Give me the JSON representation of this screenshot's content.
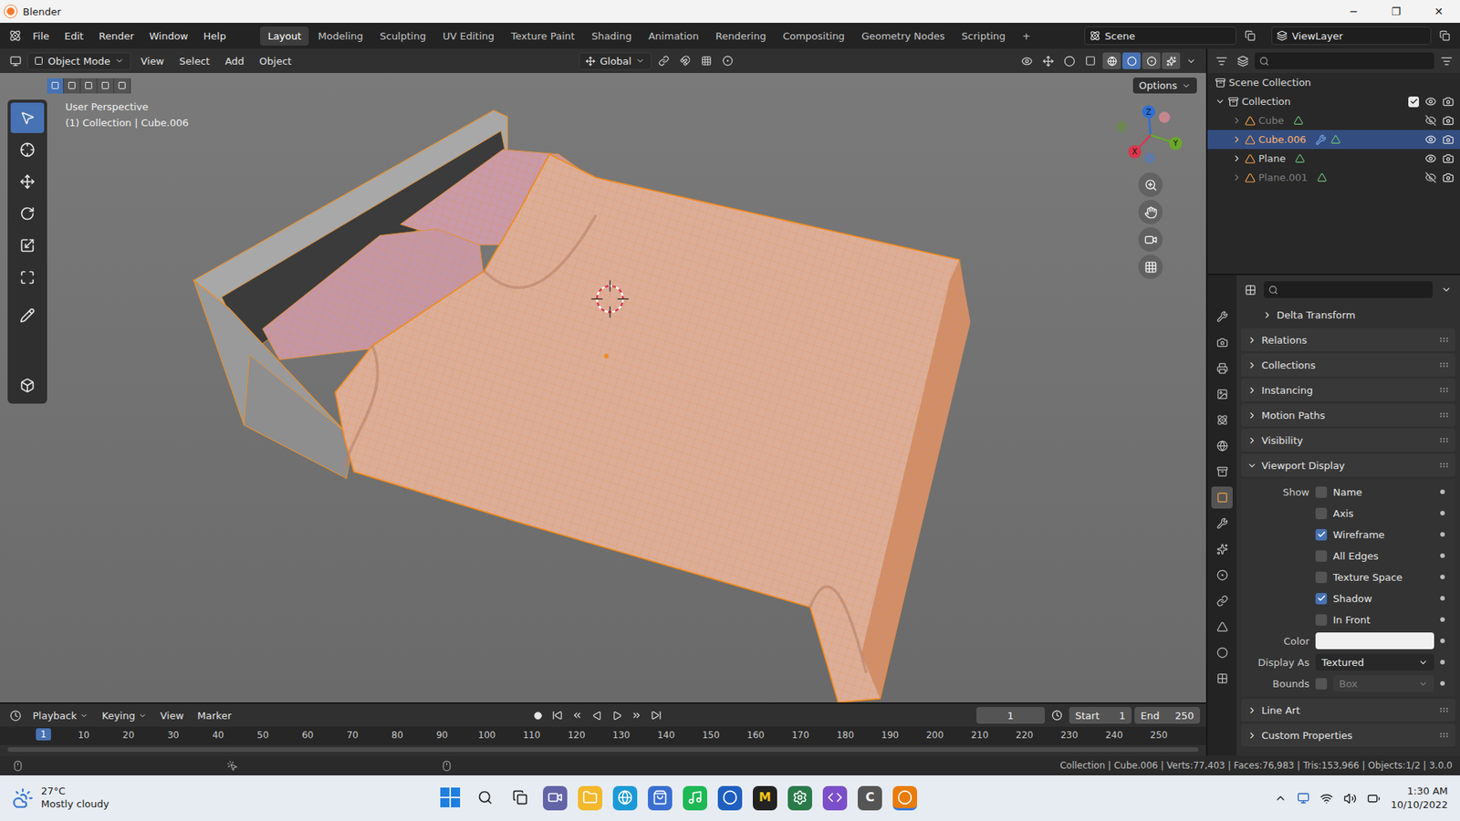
{
  "window": {
    "title": "Blender",
    "controls": [
      "─",
      "❐",
      "✕"
    ]
  },
  "menus": [
    "File",
    "Edit",
    "Render",
    "Window",
    "Help"
  ],
  "workspaces": [
    {
      "label": "Layout",
      "selected": true
    },
    {
      "label": "Modeling",
      "selected": false
    },
    {
      "label": "Sculpting",
      "selected": false
    },
    {
      "label": "UV Editing",
      "selected": false
    },
    {
      "label": "Texture Paint",
      "selected": false
    },
    {
      "label": "Shading",
      "selected": false
    },
    {
      "label": "Animation",
      "selected": false
    },
    {
      "label": "Rendering",
      "selected": false
    },
    {
      "label": "Compositing",
      "selected": false
    },
    {
      "label": "Geometry Nodes",
      "selected": false
    },
    {
      "label": "Scripting",
      "selected": false
    }
  ],
  "add_workspace": "+",
  "scene": "Scene",
  "view_layer": "ViewLayer",
  "viewport_header": {
    "mode": "Object Mode",
    "menus": [
      "View",
      "Select",
      "Add",
      "Object"
    ],
    "orientation": "Global",
    "shading": [
      {
        "kind": "wireframe",
        "selected": false
      },
      {
        "kind": "solid",
        "selected": true
      },
      {
        "kind": "material",
        "selected": false
      },
      {
        "kind": "rendered",
        "selected": false
      }
    ]
  },
  "viewport": {
    "view": "User Perspective",
    "context": "(1) Collection | Cube.006",
    "options": "Options",
    "select_modes": [
      {
        "selected": true
      },
      {
        "selected": false
      },
      {
        "selected": false
      },
      {
        "selected": false
      },
      {
        "selected": false
      }
    ],
    "axes": [
      {
        "label": "Z",
        "color": "#2f6fd6"
      },
      {
        "label": "Y",
        "color": "#6aa82c"
      },
      {
        "label": "X",
        "color": "#d9374b"
      }
    ]
  },
  "tools": [
    {
      "kind": "select",
      "selected": true
    },
    {
      "kind": "cursor",
      "selected": false
    },
    {
      "kind": "move",
      "selected": false
    },
    {
      "kind": "rotate",
      "selected": false
    },
    {
      "kind": "scale",
      "selected": false
    },
    {
      "kind": "transform",
      "selected": false
    },
    {
      "kind": "annotate",
      "selected": false
    },
    {
      "kind": "measure",
      "selected": false
    },
    {
      "kind": "add-cube",
      "selected": false
    }
  ],
  "outliner": {
    "root": "Scene Collection",
    "collection": {
      "label": "Collection",
      "checked": true,
      "expanded": true
    },
    "items": [
      {
        "label": "Cube",
        "selected": false,
        "visible": false,
        "has_modifier": false
      },
      {
        "label": "Cube.006",
        "selected": true,
        "visible": true,
        "has_modifier": true
      },
      {
        "label": "Plane",
        "selected": false,
        "visible": true,
        "has_modifier": false
      },
      {
        "label": "Plane.001",
        "selected": false,
        "visible": false,
        "has_modifier": false
      }
    ]
  },
  "properties": {
    "tabs": [
      {
        "kind": "tool",
        "selected": false
      },
      {
        "kind": "render",
        "selected": false
      },
      {
        "kind": "output",
        "selected": false
      },
      {
        "kind": "view-layer",
        "selected": false
      },
      {
        "kind": "scene",
        "selected": false
      },
      {
        "kind": "world",
        "selected": false
      },
      {
        "kind": "collection",
        "selected": false
      },
      {
        "kind": "object",
        "selected": true
      },
      {
        "kind": "modifiers",
        "selected": false
      },
      {
        "kind": "particles",
        "selected": false
      },
      {
        "kind": "physics",
        "selected": false
      },
      {
        "kind": "constraints",
        "selected": false
      },
      {
        "kind": "data",
        "selected": false
      },
      {
        "kind": "material",
        "selected": false
      },
      {
        "kind": "texture",
        "selected": false
      }
    ],
    "sections": [
      {
        "label": "Delta Transform",
        "expanded": false,
        "nested": true
      },
      {
        "label": "Relations",
        "expanded": false,
        "nested": false
      },
      {
        "label": "Collections",
        "expanded": false,
        "nested": false
      },
      {
        "label": "Instancing",
        "expanded": false,
        "nested": false
      },
      {
        "label": "Motion Paths",
        "expanded": false,
        "nested": false
      },
      {
        "label": "Visibility",
        "expanded": false,
        "nested": false
      },
      {
        "label": "Viewport Display",
        "expanded": true,
        "nested": false
      },
      {
        "label": "Line Art",
        "expanded": false,
        "nested": false
      },
      {
        "label": "Custom Properties",
        "expanded": false,
        "nested": false
      }
    ],
    "viewport_display": {
      "show_label": "Show",
      "checks": [
        {
          "label": "Name",
          "checked": false
        },
        {
          "label": "Axis",
          "checked": false
        },
        {
          "label": "Wireframe",
          "checked": true
        },
        {
          "label": "All Edges",
          "checked": false
        },
        {
          "label": "Texture Space",
          "checked": false
        },
        {
          "label": "Shadow",
          "checked": true
        },
        {
          "label": "In Front",
          "checked": false
        }
      ],
      "color_label": "Color",
      "swatch": "#f0f0f0",
      "display_as_label": "Display As",
      "display_as": "Textured",
      "bounds_label": "Bounds",
      "bounds_checked": false,
      "bounds_type": "Box",
      "bounds_type_disabled": true
    }
  },
  "timeline": {
    "menus": [
      "Playback",
      "Keying",
      "View",
      "Marker"
    ],
    "current_frame": "1",
    "start_label": "Start",
    "start": "1",
    "end_label": "End",
    "end": "250",
    "playhead": "1",
    "ticks": [
      "1",
      "10",
      "20",
      "30",
      "40",
      "50",
      "60",
      "70",
      "80",
      "90",
      "100",
      "110",
      "120",
      "130",
      "140",
      "150",
      "160",
      "170",
      "180",
      "190",
      "200",
      "210",
      "220",
      "230",
      "240",
      "250"
    ]
  },
  "status_bar": {
    "stats": "Collection | Cube.006 | Verts:77,403 | Faces:76,983 | Tris:153,966 | Objects:1/2 | 3.0.0"
  },
  "taskbar": {
    "weather": {
      "temp": "27°C",
      "desc": "Mostly cloudy"
    },
    "apps": [
      {
        "kind": "start",
        "active": false
      },
      {
        "kind": "search",
        "active": false
      },
      {
        "kind": "task-view",
        "active": false
      },
      {
        "kind": "teams",
        "active": false
      },
      {
        "kind": "explorer",
        "active": false
      },
      {
        "kind": "edge",
        "active": false
      },
      {
        "kind": "store",
        "active": false
      },
      {
        "kind": "spotify",
        "active": false
      },
      {
        "kind": "word-app",
        "active": false
      },
      {
        "kind": "m-app",
        "active": false,
        "glyph": "M"
      },
      {
        "kind": "gear-app",
        "active": false
      },
      {
        "kind": "visual-studio",
        "active": false
      },
      {
        "kind": "c-app",
        "active": false,
        "glyph": "C"
      },
      {
        "kind": "blender",
        "active": true
      }
    ],
    "time": "1:30 AM",
    "date": "10/10/2022"
  }
}
